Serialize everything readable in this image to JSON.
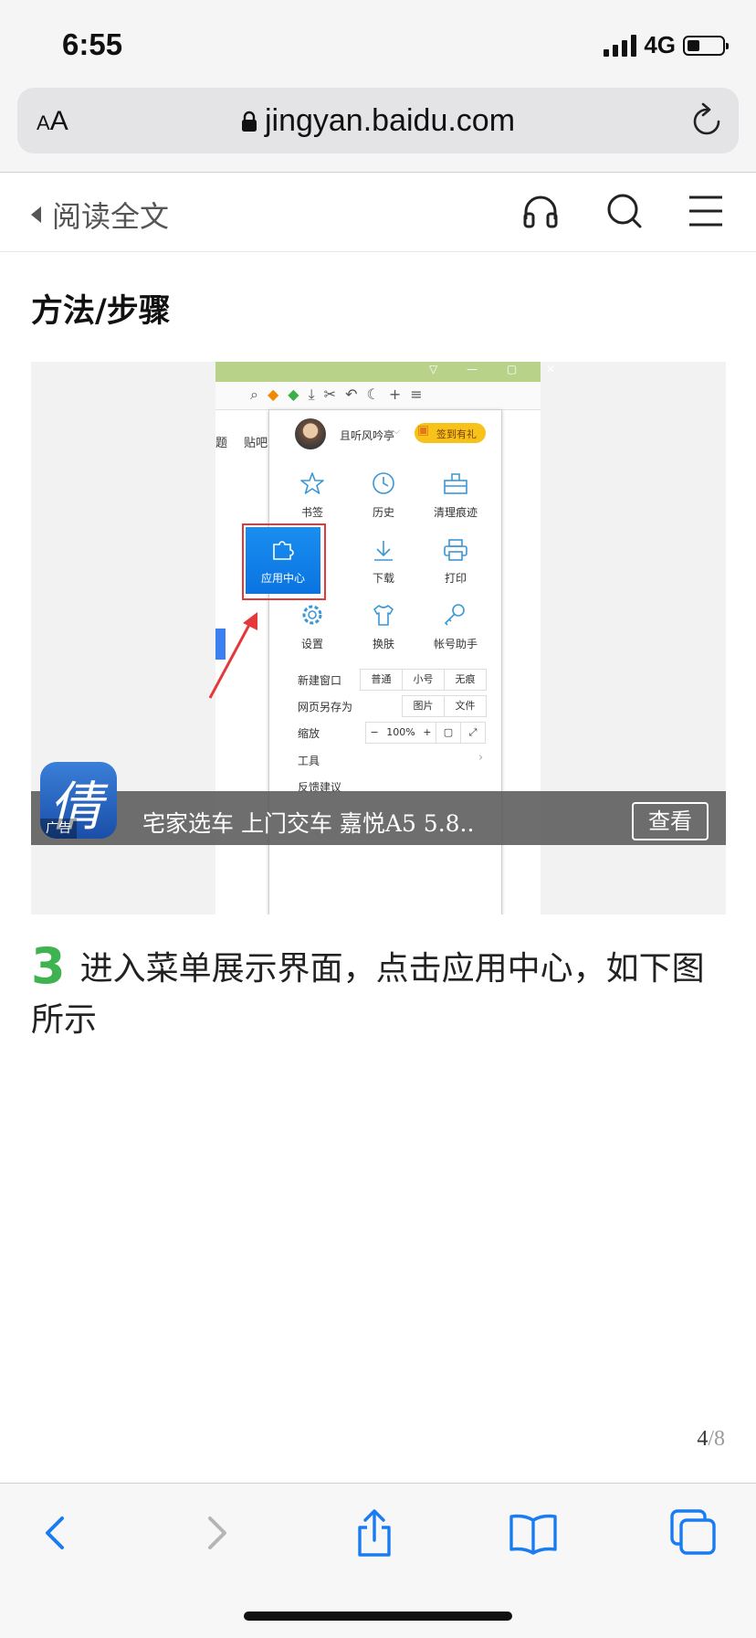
{
  "status": {
    "time": "6:55",
    "network": "4G",
    "battery_level": 0.35
  },
  "browser": {
    "text_size_label": "AA",
    "url": "jingyan.baidu.com"
  },
  "header": {
    "back_label": "阅读全文"
  },
  "article": {
    "section_title": "方法/步骤",
    "figure": {
      "user_name": "且听风吟亭",
      "sign_badge": "签到有礼",
      "menu_items": [
        "书签",
        "历史",
        "清理痕迹",
        "应用中心",
        "下载",
        "打印",
        "设置",
        "换肤",
        "帐号助手"
      ],
      "new_window_label": "新建窗口",
      "new_window_options": [
        "普通",
        "小号",
        "无痕"
      ],
      "save_page_label": "网页另存为",
      "save_page_options": [
        "图片",
        "文件"
      ],
      "zoom_label": "缩放",
      "zoom_minus": "−",
      "zoom_value": "100%",
      "zoom_plus": "+",
      "tools_label": "工具",
      "feedback_label": "反馈建议",
      "left_fragment_1": "题",
      "left_fragment_2": "贴吧"
    },
    "ad": {
      "tag": "广告",
      "text": "宅家选车 上门交车 嘉悦A5 5.8..",
      "button": "查看"
    },
    "step": {
      "number": "3",
      "text": "进入菜单展示界面，点击应用中心，如下图所示"
    },
    "page_current": "4",
    "page_total": "/8"
  },
  "colors": {
    "accent_green": "#3fb34f",
    "ios_blue": "#1a7cf0",
    "menu_blue": "#3a97d6",
    "highlight_red": "#e5383b"
  }
}
